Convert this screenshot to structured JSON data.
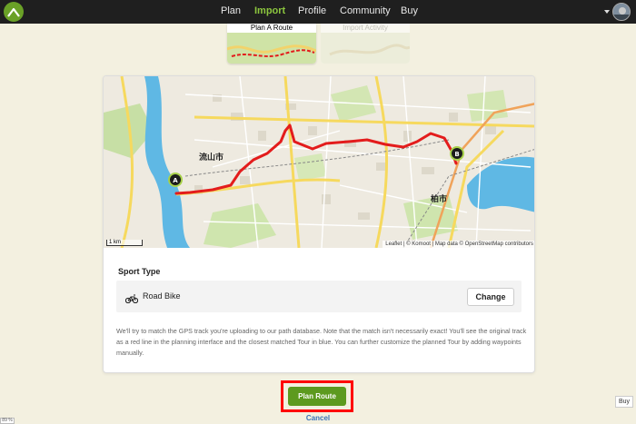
{
  "nav": {
    "logo_icon": "komoot-logo-icon",
    "items": [
      {
        "label": "Plan",
        "active": false
      },
      {
        "label": "Import",
        "active": true
      },
      {
        "label": "Profile",
        "active": false
      },
      {
        "label": "Community",
        "active": false
      },
      {
        "label": "Buy",
        "active": false
      }
    ]
  },
  "import_cards": {
    "plan_route_label": "Plan A Route",
    "import_activity_label": "Import Activity"
  },
  "map": {
    "attribution": "Leaflet | © Komoot | Map data © OpenStreetMap contributors",
    "scale_label": "1 km",
    "start_marker": "A",
    "end_marker": "B",
    "place_labels": [
      "流山市",
      "柏市"
    ],
    "route_color": "#e31c1c"
  },
  "sport": {
    "title": "Sport Type",
    "icon": "road-bike-icon",
    "name": "Road Bike",
    "change_label": "Change"
  },
  "description": "We'll try to match the GPS track you're uploading to our path database. Note that the match isn't necessarily exact! You'll see the original track as a red line in the planning interface and the closest matched Tour in blue. You can further customize the planned Tour by adding waypoints manually.",
  "actions": {
    "plan_route_label": "Plan Route",
    "cancel_label": "Cancel"
  },
  "side_buy_label": "Buy",
  "zoom_label": "89 %",
  "colors": {
    "accent": "#5d9a1f",
    "nav_active": "#8cc63e",
    "highlight_outline": "#ff0000",
    "link": "#3a72b6"
  }
}
